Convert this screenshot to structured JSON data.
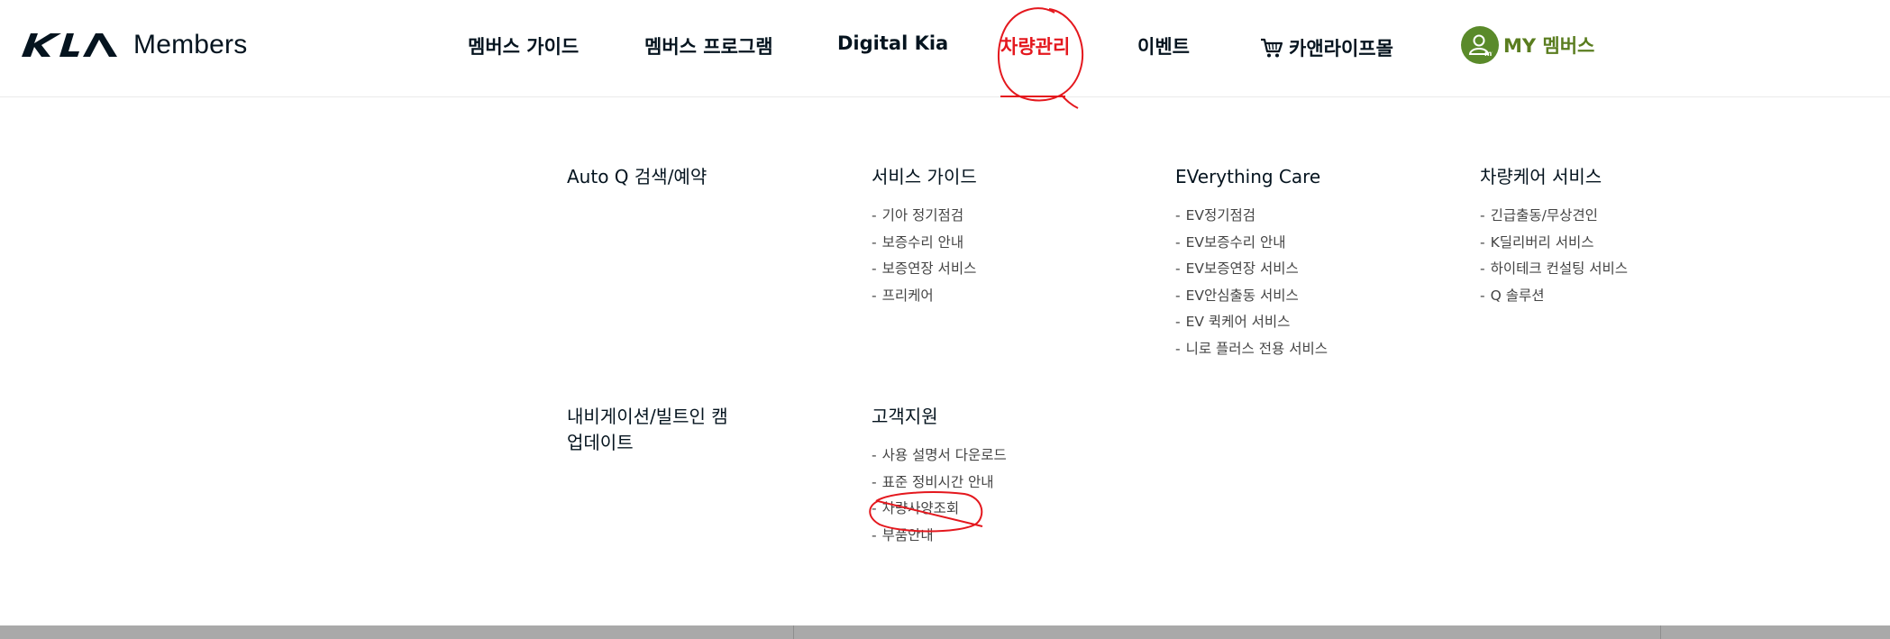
{
  "brand": {
    "logo_text": "Members"
  },
  "nav": {
    "items": [
      {
        "label": "멤버스 가이드"
      },
      {
        "label": "멤버스 프로그램"
      },
      {
        "label": "Digital Kia"
      },
      {
        "label": "차량관리"
      },
      {
        "label": "이벤트"
      }
    ],
    "cart_label": "카앤라이프몰",
    "my_label": "MY 멤버스"
  },
  "menu": {
    "col1": {
      "title": "Auto Q 검색/예약"
    },
    "col2": {
      "title": "서비스 가이드",
      "items": [
        "기아 정기점검",
        "보증수리 안내",
        "보증연장 서비스",
        "프리케어"
      ]
    },
    "col3": {
      "title": "EVerything Care",
      "items": [
        "EV정기점검",
        "EV보증수리 안내",
        "EV보증연장 서비스",
        "EV안심출동 서비스",
        "EV 퀵케어 서비스",
        "니로 플러스 전용 서비스"
      ]
    },
    "col4": {
      "title": "차량케어 서비스",
      "items": [
        "긴급출동/무상견인",
        "K딜리버리 서비스",
        "하이테크 컨설팅 서비스",
        "Q 솔루션"
      ]
    },
    "col5": {
      "title": "내비게이션/빌트인 캠 업데이트"
    },
    "col6": {
      "title": "고객지원",
      "items": [
        "사용 설명서 다운로드",
        "표준 정비시간 안내",
        "차량사양조회",
        "부품안내"
      ]
    },
    "dash": "-"
  },
  "colors": {
    "active": "#e4181e",
    "my_green": "#5a8a2a",
    "annotation": "#e4181e"
  }
}
